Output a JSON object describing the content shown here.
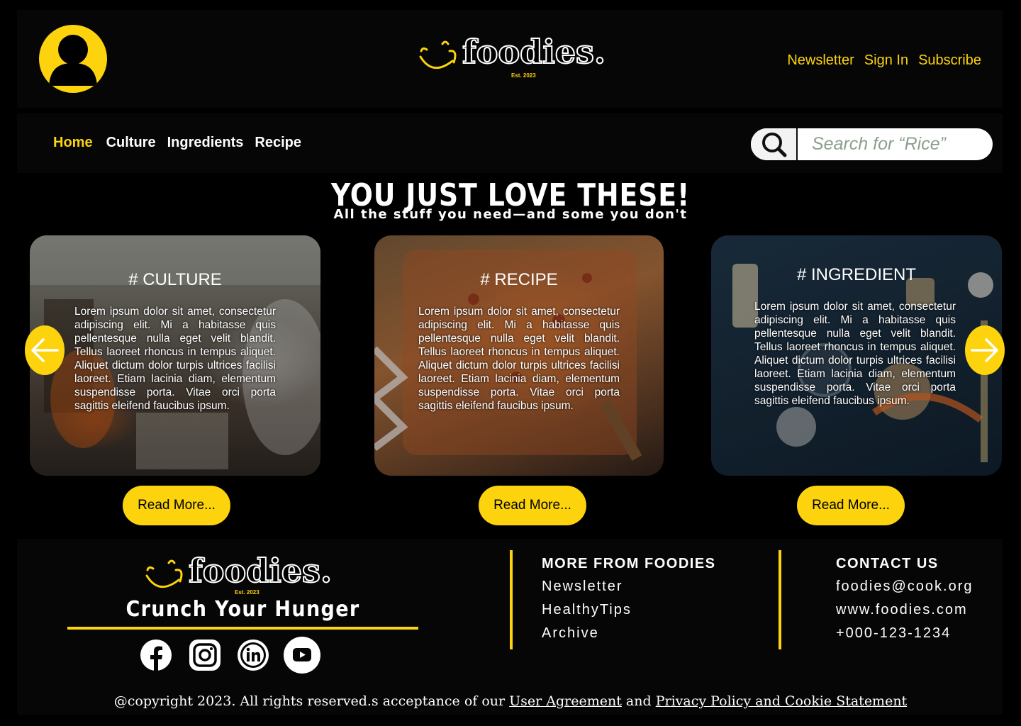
{
  "header": {
    "logo_text": "foodies.",
    "logo_est": "Est. 2023",
    "links": [
      "Newsletter",
      "Sign In",
      "Subscribe"
    ]
  },
  "nav": {
    "items": [
      "Home",
      "Culture",
      "Ingredients",
      "Recipe"
    ],
    "active": "Home"
  },
  "search": {
    "placeholder": "Search for “Rice”"
  },
  "hero": {
    "title": "YOU JUST LOVE THESE!",
    "subtitle": "All the stuff you need—and some you don't"
  },
  "cards": [
    {
      "tag": "# CULTURE",
      "body": "Lorem ipsum dolor sit amet, consectetur adipiscing elit. Mi a habitasse quis pellentesque nulla eget velit blandit. Tellus laoreet rhoncus in tempus aliquet. Aliquet dictum dolor turpis ultrices facilisi laoreet. Etiam lacinia diam, elementum suspendisse porta. Vitae orci porta sagittis eleifend faucibus ipsum.",
      "button": "Read More..."
    },
    {
      "tag": "# RECIPE",
      "body": "Lorem ipsum dolor sit amet, consectetur adipiscing elit. Mi a habitasse quis pellentesque nulla eget velit blandit. Tellus laoreet rhoncus in tempus aliquet. Aliquet dictum dolor turpis ultrices facilisi laoreet. Etiam lacinia diam, elementum suspendisse porta. Vitae orci porta sagittis eleifend faucibus ipsum.",
      "button": "Read More..."
    },
    {
      "tag": "# INGREDIENT",
      "body": "Lorem ipsum dolor sit amet, consectetur adipiscing elit. Mi a habitasse quis pellentesque nulla eget velit blandit. Tellus laoreet rhoncus in tempus aliquet. Aliquet dictum dolor turpis ultrices facilisi laoreet. Etiam lacinia diam, elementum suspendisse porta. Vitae orci porta sagittis eleifend faucibus ipsum.",
      "button": "Read More..."
    }
  ],
  "footer": {
    "tagline": "Crunch Your Hunger",
    "social_icons": [
      "facebook-icon",
      "instagram-icon",
      "linkedin-icon",
      "youtube-icon"
    ],
    "more_title": "MORE FROM FOODIES",
    "more_links": [
      "Newsletter",
      "HealthyTips",
      "Archive"
    ],
    "contact_title": "CONTACT US",
    "contact_items": [
      "foodies@cook.org",
      "www.foodies.com",
      "+000-123-1234"
    ],
    "copyright_prefix": "@copyright 2023. All rights reserved.s acceptance of our",
    "user_agreement": "User Agreement",
    "and_text": "and",
    "privacy": "Privacy Policy and Cookie Statement"
  },
  "colors": {
    "accent": "#fcd30c",
    "panel": "#060606",
    "background": "#000000"
  }
}
